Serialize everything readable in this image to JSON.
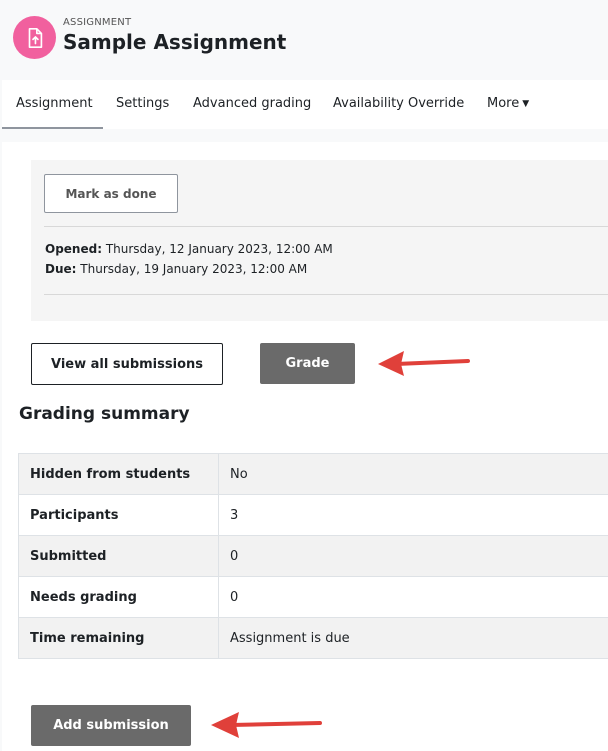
{
  "header": {
    "pretitle": "ASSIGNMENT",
    "title": "Sample Assignment",
    "icon": "assignment-upload-icon",
    "icon_color": "#f1609e"
  },
  "nav": {
    "tabs": [
      {
        "label": "Assignment",
        "active": true
      },
      {
        "label": "Settings"
      },
      {
        "label": "Advanced grading"
      },
      {
        "label": "Availability Override"
      },
      {
        "label": "More"
      }
    ]
  },
  "dates": {
    "mark_done_label": "Mark as done",
    "opened_label": "Opened:",
    "opened_value": "Thursday, 12 January 2023, 12:00 AM",
    "due_label": "Due:",
    "due_value": "Thursday, 19 January 2023, 12:00 AM"
  },
  "actions": {
    "view_all_label": "View all submissions",
    "grade_label": "Grade",
    "add_submission_label": "Add submission"
  },
  "summary": {
    "title": "Grading summary",
    "rows": [
      {
        "key": "Hidden from students",
        "value": "No"
      },
      {
        "key": "Participants",
        "value": "3"
      },
      {
        "key": "Submitted",
        "value": "0"
      },
      {
        "key": "Needs grading",
        "value": "0"
      },
      {
        "key": "Time remaining",
        "value": "Assignment is due"
      }
    ]
  },
  "colors": {
    "annotation_arrow": "#e0403a",
    "dark_button": "#6a6a6a"
  }
}
